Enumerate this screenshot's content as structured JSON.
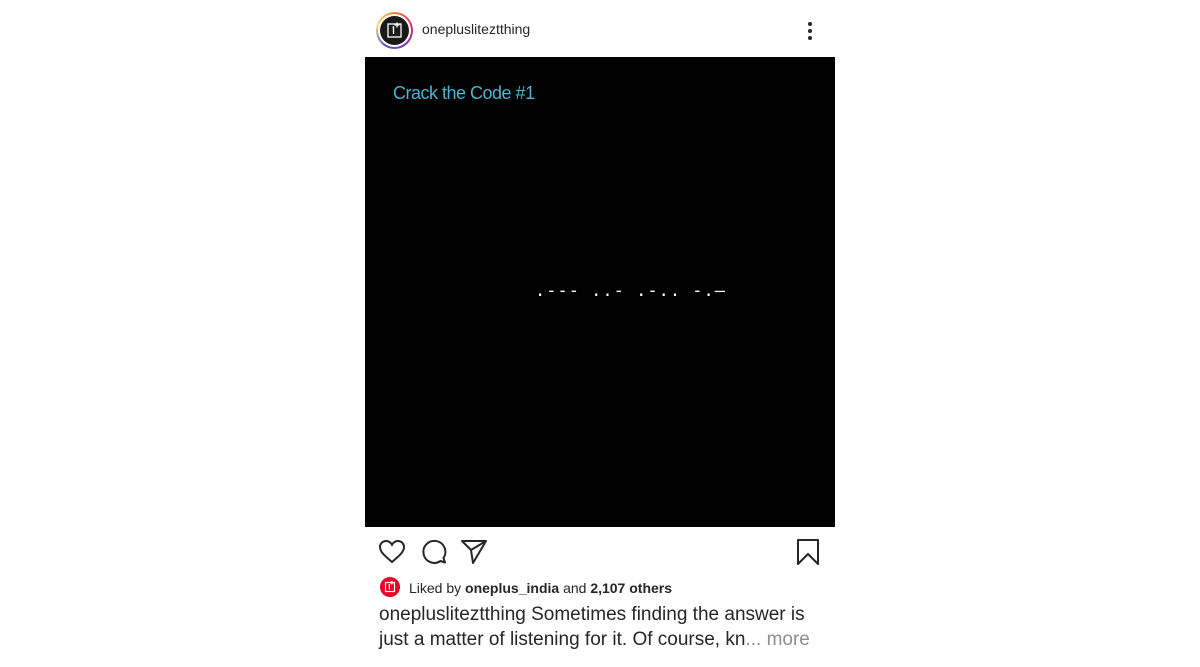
{
  "header": {
    "username": "oneplusliteztthing",
    "more_icon": "more-vertical-icon"
  },
  "image": {
    "title": "Crack the Code #1",
    "morse": ".--- ..- .-.. -.—",
    "title_color": "#4fb3cf",
    "background": "#000000"
  },
  "actions": {
    "like_icon": "heart-icon",
    "comment_icon": "comment-icon",
    "share_icon": "send-icon",
    "save_icon": "bookmark-icon"
  },
  "likes": {
    "prefix": "Liked by",
    "liker": "oneplus_india",
    "conjunction": "and",
    "others": "2,107 others",
    "liker_avatar_color": "#eb0029"
  },
  "caption": {
    "username": "oneplusliteztthing",
    "text": "Sometimes finding the answer is just a matter of listening for it. Of course, kn",
    "ellipsis": "...",
    "more": "more"
  }
}
